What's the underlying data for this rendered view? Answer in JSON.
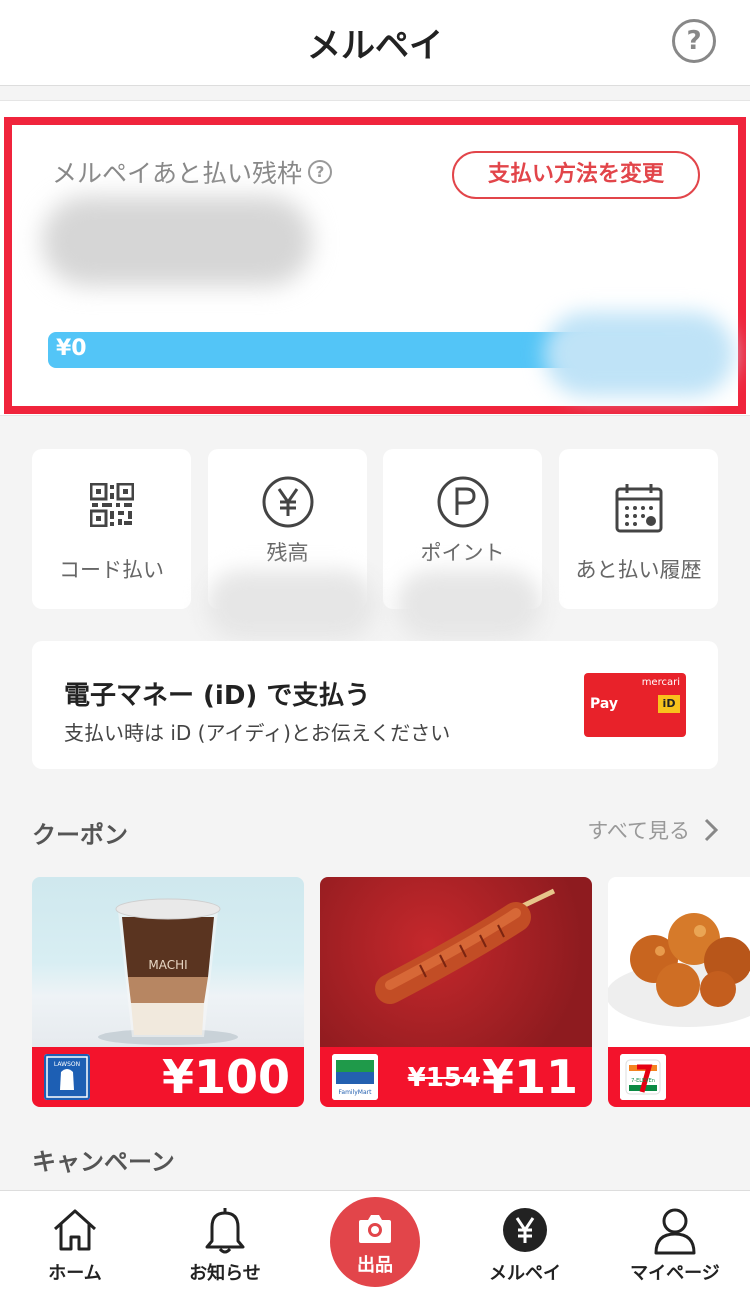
{
  "header": {
    "title": "メルペイ",
    "help_icon": "question-circle-icon"
  },
  "limit": {
    "label": "メルペイあと払い残枠",
    "change_button": "支払い方法を変更",
    "progress_amount": "¥0",
    "progress_fraction": 0.83
  },
  "quick_actions": [
    {
      "label": "コード払い",
      "icon": "qr-code-icon"
    },
    {
      "label": "残高",
      "icon": "yen-circle-icon"
    },
    {
      "label": "ポイント",
      "icon": "point-circle-icon"
    },
    {
      "label": "あと払い履歴",
      "icon": "calendar-icon"
    }
  ],
  "id_payment": {
    "title": "電子マネー (iD) で支払う",
    "subtitle": "支払い時は iD (アイディ)とお伝えください",
    "logo_brand": "mercari",
    "logo_pay": "Pay",
    "logo_id": "iD"
  },
  "coupons": {
    "title": "クーポン",
    "see_all": "すべて見る",
    "items": [
      {
        "store": "LAWSON",
        "price": "¥100",
        "old_price": ""
      },
      {
        "store": "FamilyMart",
        "price": "¥11",
        "old_price": "¥154"
      },
      {
        "store": "7-ELEVEn",
        "price": "",
        "old_price": ""
      }
    ]
  },
  "campaign": {
    "title": "キャンペーン"
  },
  "tabs": [
    {
      "label": "ホーム",
      "icon": "home-icon"
    },
    {
      "label": "お知らせ",
      "icon": "bell-icon"
    },
    {
      "label": "出品",
      "icon": "camera-icon"
    },
    {
      "label": "メルペイ",
      "icon": "yen-icon"
    },
    {
      "label": "マイページ",
      "icon": "person-icon"
    }
  ],
  "colors": {
    "accent": "#e2454a",
    "progress": "#53c5f7",
    "coupon_bar": "#f3132c",
    "highlight": "#f0243c"
  }
}
